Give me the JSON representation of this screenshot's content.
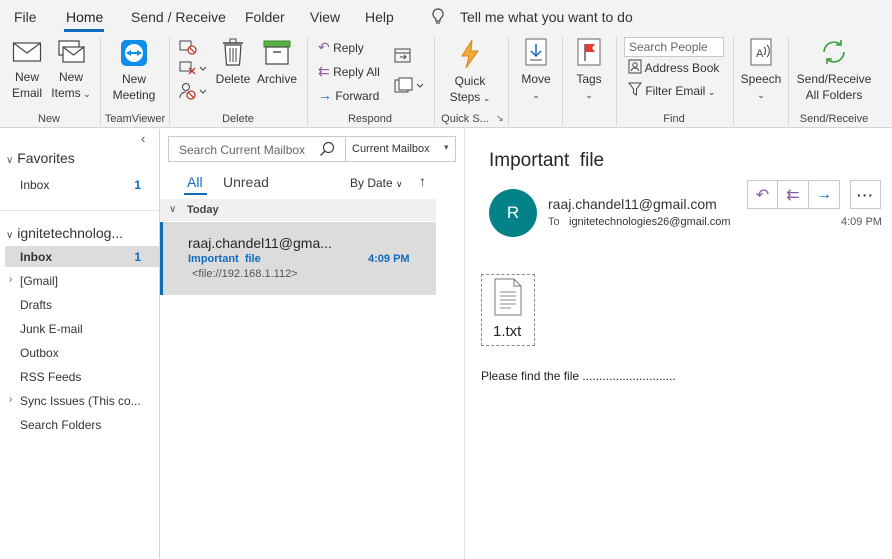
{
  "tabs": {
    "file": "File",
    "home": "Home",
    "send_receive": "Send / Receive",
    "folder": "Folder",
    "view": "View",
    "help": "Help",
    "tell_me": "Tell me what you want to do"
  },
  "ribbon": {
    "new_email_1": "New",
    "new_email_2": "Email",
    "new_items_1": "New",
    "new_items_2": "Items",
    "new_meeting_1": "New",
    "new_meeting_2": "Meeting",
    "delete": "Delete",
    "archive": "Archive",
    "reply": "Reply",
    "reply_all": "Reply All",
    "forward": "Forward",
    "quick_steps_1": "Quick",
    "quick_steps_2": "Steps",
    "move": "Move",
    "tags": "Tags",
    "search_people": "Search People",
    "address_book": "Address Book",
    "filter_email": "Filter Email",
    "speech": "Speech",
    "send_receive_1": "Send/Receive",
    "send_receive_2": "All Folders",
    "group_new": "New",
    "group_teamviewer": "TeamViewer",
    "group_delete": "Delete",
    "group_respond": "Respond",
    "group_quick": "Quick S...",
    "group_find": "Find",
    "group_send_receive": "Send/Receive"
  },
  "nav": {
    "favorites": "Favorites",
    "fav_inbox": "Inbox",
    "fav_inbox_count": "1",
    "account": "ignitetechnolog...",
    "inbox": "Inbox",
    "inbox_count": "1",
    "folders": [
      "[Gmail]",
      "Drafts",
      "Junk E-mail",
      "Outbox",
      "RSS Feeds",
      "Sync Issues (This co...",
      "Search Folders"
    ]
  },
  "list": {
    "search_placeholder": "Search Current Mailbox",
    "scope": "Current Mailbox",
    "tab_all": "All",
    "tab_unread": "Unread",
    "sort": "By Date",
    "group_today": "Today",
    "item": {
      "from": "raaj.chandel11@gma...",
      "subject": "Important  file",
      "time": "4:09 PM",
      "preview": "<file://192.168.1.112>"
    }
  },
  "reading": {
    "subject": "Important  file",
    "avatar_letter": "R",
    "from": "raaj.chandel11@gmail.com",
    "to_label": "To",
    "to": "ignitetechnologies26@gmail.com",
    "time": "4:09 PM",
    "attachment_name": "1.txt",
    "body": "Please find the file ............................"
  },
  "colors": {
    "accent": "#0f6cbd",
    "avatar": "#038387",
    "selected_item": "#dcdcdc",
    "reply_purple": "#8a5ca8"
  }
}
